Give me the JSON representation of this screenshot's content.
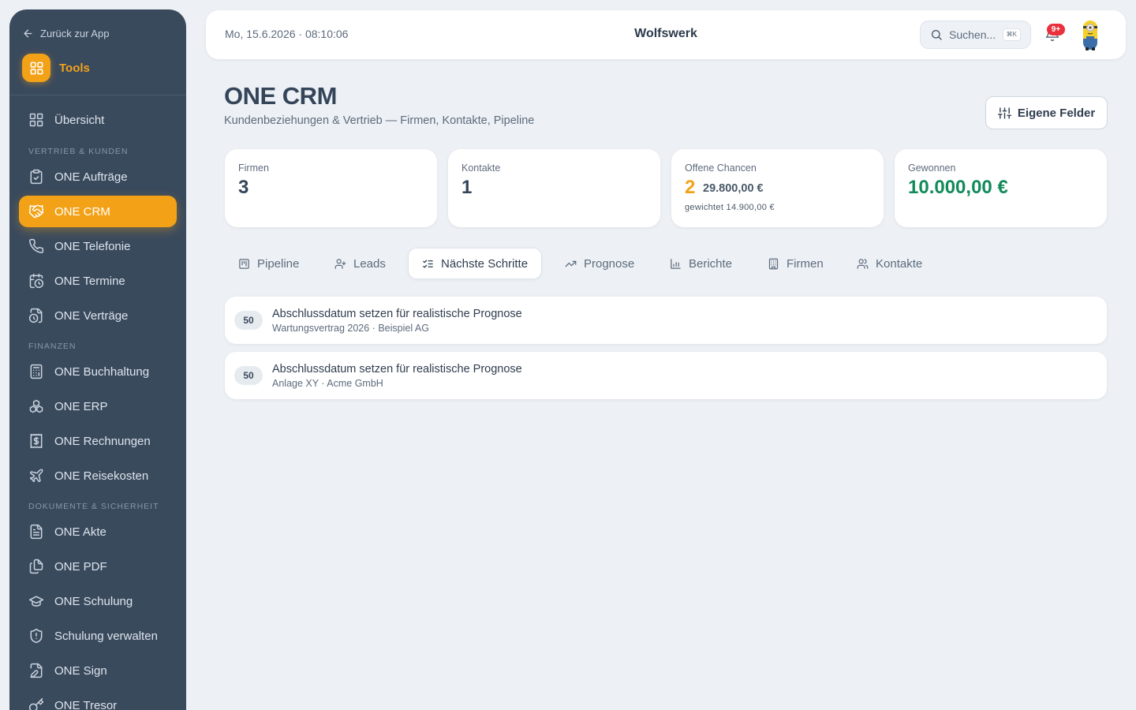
{
  "sidebar": {
    "back_label": "Zurück zur App",
    "tools_label": "Tools",
    "overview_label": "Übersicht",
    "sections": {
      "sales": "VERTRIEB & KUNDEN",
      "finance": "FINANZEN",
      "docs": "DOKUMENTE & SICHERHEIT"
    },
    "items": [
      {
        "label": "ONE Aufträge",
        "icon": "clipboard-check-icon"
      },
      {
        "label": "ONE CRM",
        "icon": "handshake-icon",
        "active": true
      },
      {
        "label": "ONE Telefonie",
        "icon": "phone-icon"
      },
      {
        "label": "ONE Termine",
        "icon": "calendar-clock-icon"
      },
      {
        "label": "ONE Verträge",
        "icon": "file-clock-icon"
      },
      {
        "label": "ONE Buchhaltung",
        "icon": "calculator-icon"
      },
      {
        "label": "ONE ERP",
        "icon": "boxes-icon"
      },
      {
        "label": "ONE Rechnungen",
        "icon": "receipt-dollar-icon"
      },
      {
        "label": "ONE Reisekosten",
        "icon": "plane-icon"
      },
      {
        "label": "ONE Akte",
        "icon": "file-text-icon"
      },
      {
        "label": "ONE PDF",
        "icon": "files-icon"
      },
      {
        "label": "ONE Schulung",
        "icon": "graduation-cap-icon"
      },
      {
        "label": "Schulung verwalten",
        "icon": "shield-icon"
      },
      {
        "label": "ONE Sign",
        "icon": "file-signature-icon"
      },
      {
        "label": "ONE Tresor",
        "icon": "key-icon"
      }
    ]
  },
  "header": {
    "datetime": "Mo, 15.6.2026 · 08:10:06",
    "org_name": "Wolfswerk",
    "search_placeholder": "Suchen...",
    "search_shortcut": "⌘K",
    "notification_count": "9+"
  },
  "page": {
    "title": "ONE CRM",
    "subtitle": "Kundenbeziehungen & Vertrieb — Firmen, Kontakte, Pipeline",
    "custom_fields_button": "Eigene Felder"
  },
  "stats": {
    "companies": {
      "label": "Firmen",
      "value": "3"
    },
    "contacts": {
      "label": "Kontakte",
      "value": "1"
    },
    "open": {
      "label": "Offene Chancen",
      "value": "2",
      "amount": "29.800,00 €",
      "weighted": "gewichtet 14.900,00 €"
    },
    "won": {
      "label": "Gewonnen",
      "value": "10.000,00 €"
    }
  },
  "tabs": [
    {
      "label": "Pipeline",
      "icon": "kanban-icon"
    },
    {
      "label": "Leads",
      "icon": "user-plus-icon"
    },
    {
      "label": "Nächste Schritte",
      "icon": "list-checks-icon",
      "active": true
    },
    {
      "label": "Prognose",
      "icon": "trending-up-icon"
    },
    {
      "label": "Berichte",
      "icon": "bar-chart-icon"
    },
    {
      "label": "Firmen",
      "icon": "building-icon"
    },
    {
      "label": "Kontakte",
      "icon": "users-icon"
    }
  ],
  "next_steps": [
    {
      "score": "50",
      "title": "Abschlussdatum setzen für realistische Prognose",
      "meta": "Wartungsvertrag 2026 · Beispiel AG"
    },
    {
      "score": "50",
      "title": "Abschlussdatum setzen für realistische Prognose",
      "meta": "Anlage XY · Acme GmbH"
    }
  ],
  "colors": {
    "accent": "#f3a218",
    "sidebar": "#3a4a5d",
    "success": "#128a5a",
    "danger": "#e8313c"
  }
}
